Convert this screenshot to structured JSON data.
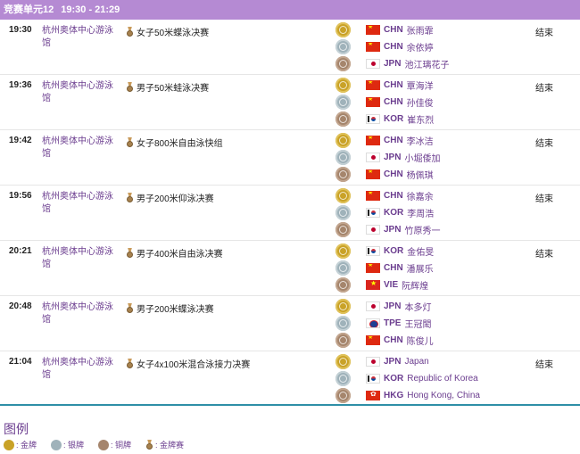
{
  "header": {
    "unit": "竞赛单元12",
    "time": "19:30 - 21:29"
  },
  "colors": {
    "header_bg": "#b58ad3",
    "link_purple": "#6b3d8f",
    "gold": "#c9a227",
    "silver": "#9fb2ba",
    "bronze": "#a5856c"
  },
  "events": [
    {
      "time": "19:30",
      "venue": "杭州奥体中心游泳馆",
      "title": "女子50米蝶泳决赛",
      "status": "结束",
      "medalists": [
        {
          "medal": "gold",
          "flag": "chn",
          "noc": "CHN",
          "name": "张雨霏"
        },
        {
          "medal": "silver",
          "flag": "chn",
          "noc": "CHN",
          "name": "余依婷"
        },
        {
          "medal": "bronze",
          "flag": "jpn",
          "noc": "JPN",
          "name": "池江璃花子"
        }
      ]
    },
    {
      "time": "19:36",
      "venue": "杭州奥体中心游泳馆",
      "title": "男子50米蛙泳决赛",
      "status": "结束",
      "medalists": [
        {
          "medal": "gold",
          "flag": "chn",
          "noc": "CHN",
          "name": "覃海洋"
        },
        {
          "medal": "silver",
          "flag": "chn",
          "noc": "CHN",
          "name": "孙佳俊"
        },
        {
          "medal": "bronze",
          "flag": "kor",
          "noc": "KOR",
          "name": "崔东烈"
        }
      ]
    },
    {
      "time": "19:42",
      "venue": "杭州奥体中心游泳馆",
      "title": "女子800米自由泳快组",
      "status": "结束",
      "medalists": [
        {
          "medal": "gold",
          "flag": "chn",
          "noc": "CHN",
          "name": "李冰洁"
        },
        {
          "medal": "silver",
          "flag": "jpn",
          "noc": "JPN",
          "name": "小堀倭加"
        },
        {
          "medal": "bronze",
          "flag": "chn",
          "noc": "CHN",
          "name": "杨佩琪"
        }
      ]
    },
    {
      "time": "19:56",
      "venue": "杭州奥体中心游泳馆",
      "title": "男子200米仰泳决赛",
      "status": "结束",
      "medalists": [
        {
          "medal": "gold",
          "flag": "chn",
          "noc": "CHN",
          "name": "徐嘉余"
        },
        {
          "medal": "silver",
          "flag": "kor",
          "noc": "KOR",
          "name": "李周浩"
        },
        {
          "medal": "bronze",
          "flag": "jpn",
          "noc": "JPN",
          "name": "竹原秀一"
        }
      ]
    },
    {
      "time": "20:21",
      "venue": "杭州奥体中心游泳馆",
      "title": "男子400米自由泳决赛",
      "status": "结束",
      "medalists": [
        {
          "medal": "gold",
          "flag": "kor",
          "noc": "KOR",
          "name": "金佑旻"
        },
        {
          "medal": "silver",
          "flag": "chn",
          "noc": "CHN",
          "name": "潘展乐"
        },
        {
          "medal": "bronze",
          "flag": "vie",
          "noc": "VIE",
          "name": "阮辉煌"
        }
      ]
    },
    {
      "time": "20:48",
      "venue": "杭州奥体中心游泳馆",
      "title": "男子200米蝶泳决赛",
      "status": "",
      "medalists": [
        {
          "medal": "gold",
          "flag": "jpn",
          "noc": "JPN",
          "name": "本多灯"
        },
        {
          "medal": "silver",
          "flag": "tpe",
          "noc": "TPE",
          "name": "王冠閎"
        },
        {
          "medal": "bronze",
          "flag": "chn",
          "noc": "CHN",
          "name": "陈俊儿"
        }
      ]
    },
    {
      "time": "21:04",
      "venue": "杭州奥体中心游泳馆",
      "title": "女子4x100米混合泳接力决赛",
      "status": "结束",
      "medalists": [
        {
          "medal": "gold",
          "flag": "jpn",
          "noc": "JPN",
          "name": "Japan"
        },
        {
          "medal": "silver",
          "flag": "kor",
          "noc": "KOR",
          "name": "Republic of Korea"
        },
        {
          "medal": "bronze",
          "flag": "hkg",
          "noc": "HKG",
          "name": "Hong Kong, China"
        }
      ]
    }
  ],
  "legend": {
    "title": "图例",
    "items": [
      {
        "type": "gold",
        "label": ": 金牌"
      },
      {
        "type": "silver",
        "label": ": 银牌"
      },
      {
        "type": "bronze",
        "label": ": 铜牌"
      },
      {
        "type": "event",
        "label": ": 金牌赛"
      }
    ]
  }
}
